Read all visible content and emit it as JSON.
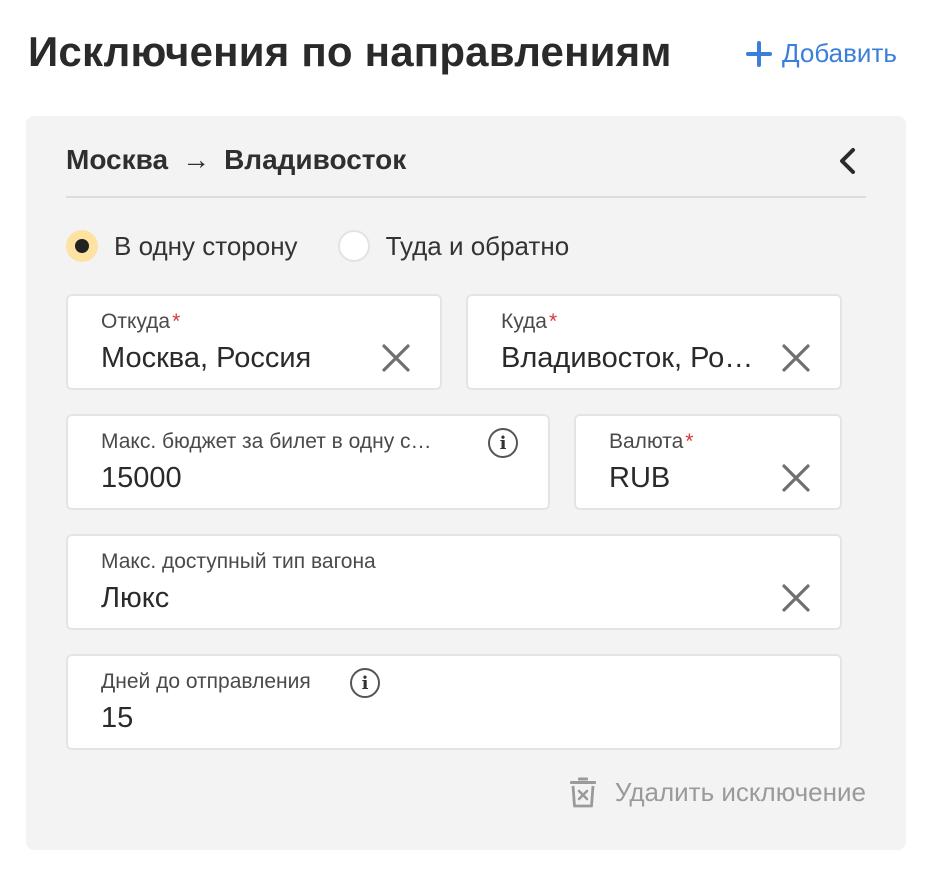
{
  "page": {
    "title": "Исключения по направлениям",
    "add_label": "Добавить"
  },
  "card": {
    "from_city": "Москва",
    "arrow": "→",
    "to_city": "Владивосток",
    "trip_type": {
      "one_way": "В одну сторону",
      "round_trip": "Туда и обратно",
      "selected": "one_way"
    },
    "fields": {
      "from": {
        "label": "Откуда",
        "required": "*",
        "value": "Москва, Россия"
      },
      "to": {
        "label": "Куда",
        "required": "*",
        "value": "Владивосток, Ро…"
      },
      "budget": {
        "label": "Макс. бюджет за билет в одну с…",
        "value": "15000",
        "info": "i"
      },
      "currency": {
        "label": "Валюта",
        "required": "*",
        "value": "RUB"
      },
      "car_type": {
        "label": "Макс. доступный тип вагона",
        "value": "Люкс"
      },
      "days": {
        "label": "Дней до отправления",
        "value": "15",
        "info": "i"
      }
    },
    "delete_label": "Удалить исключение"
  },
  "icons": [
    "plus-icon",
    "chevron-left-icon",
    "close-icon",
    "info-icon",
    "trash-icon"
  ],
  "colors": {
    "accent": "#3a7fd9",
    "radio_checked_bg": "#fde2a2",
    "required": "#d23a3a",
    "card_bg": "#f3f3f3"
  }
}
